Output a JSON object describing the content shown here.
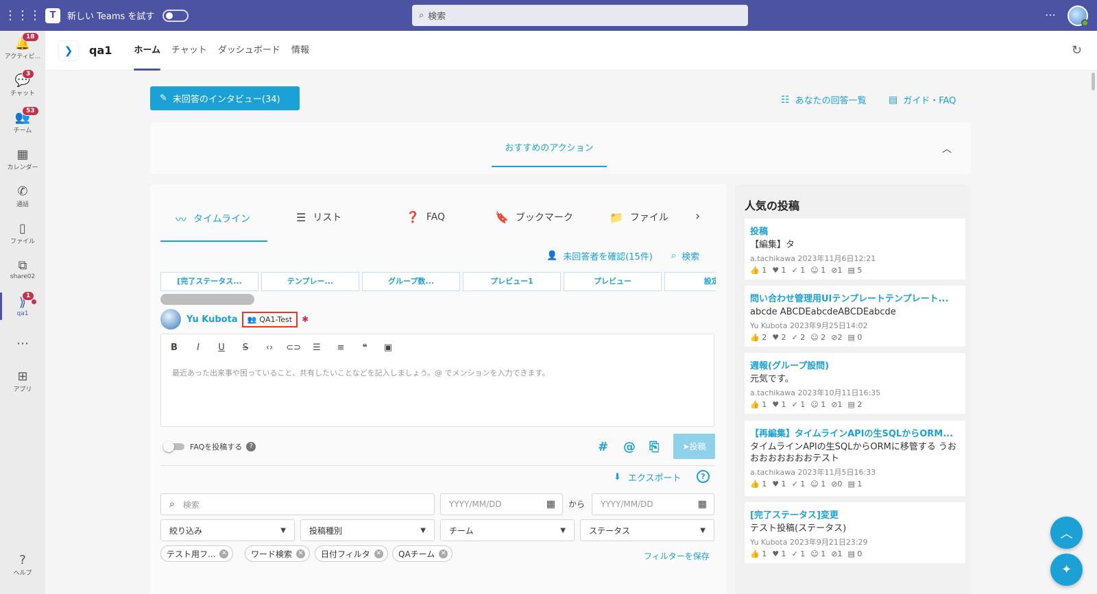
{
  "topbar": {
    "try_label": "新しい Teams を試す",
    "search_placeholder": "検索",
    "more": "⋯"
  },
  "rail": [
    {
      "label": "アクティビ...",
      "badge": "18",
      "icon": "bell-icon",
      "glyph": "🔔"
    },
    {
      "label": "チャット",
      "badge": "3",
      "icon": "chat-icon",
      "glyph": "💬"
    },
    {
      "label": "チーム",
      "badge": "53",
      "icon": "teams-icon",
      "glyph": "👥"
    },
    {
      "label": "カレンダー",
      "badge": "",
      "icon": "calendar-icon",
      "glyph": "▦"
    },
    {
      "label": "通話",
      "badge": "",
      "icon": "phone-icon",
      "glyph": "✆"
    },
    {
      "label": "ファイル",
      "badge": "",
      "icon": "file-icon",
      "glyph": "▯"
    },
    {
      "label": "share02",
      "badge": "",
      "icon": "app-icon",
      "glyph": "⧉"
    },
    {
      "label": "qa1",
      "badge": "1",
      "icon": "qa1-icon",
      "glyph": "⟫"
    },
    {
      "label": "",
      "badge": "",
      "icon": "more-icon",
      "glyph": "⋯"
    },
    {
      "label": "アプリ",
      "badge": "",
      "icon": "apps-icon",
      "glyph": "⊞"
    },
    {
      "label": "ヘルプ",
      "badge": "",
      "icon": "help-icon",
      "glyph": "?"
    }
  ],
  "app": {
    "name": "qa1",
    "tabs": [
      "ホーム",
      "チャット",
      "ダッシュボード",
      "情報"
    ]
  },
  "main": {
    "unanswered_button": "未回答のインタビュー(34)",
    "my_answers_link": "あなたの回答一覧",
    "guide_link": "ガイド・FAQ",
    "recommended_tab": "おすすめのアクション"
  },
  "timeline": {
    "tabs": [
      "タイムライン",
      "リスト",
      "FAQ",
      "ブックマーク",
      "ファイル"
    ],
    "check_unanswered": "未回答者を確認(15件)",
    "search_link": "検索",
    "chips": [
      "[完了ステータス...",
      "テンプレー...",
      "グループ数...",
      "プレビュー1",
      "プレビュー",
      "設定ｵ"
    ],
    "author_name": "Yu Kubota",
    "group_name": "QA1-Test",
    "editor_placeholder": "最近あった出来事や困っていること、共有したいことなどを記入しましょう。@ でメンションを入力できます。",
    "faq_toggle": "FAQを投稿する",
    "post_button": "投稿",
    "export": "エクスポート",
    "search_placeholder": "検索",
    "date_placeholder_from": "YYYY/MM/DD",
    "kara": "から",
    "date_placeholder_to": "YYYY/MM/DD",
    "filters": [
      "絞り込み",
      "投稿種別",
      "チーム",
      "ステータス"
    ],
    "tags": [
      "テスト用フ...",
      "ワード検索",
      "日付フィルタ",
      "QAチーム"
    ],
    "save_filter": "フィルターを保存"
  },
  "popular": {
    "title": "人気の投稿",
    "posts": [
      {
        "title": "投稿",
        "body": "【編集】タ",
        "meta": "a.tachikawa  2023年11月6日12:21",
        "stats": [
          "👍 1",
          "♥ 1",
          "✓ 1",
          "☺ 1",
          "⊘1",
          "▤ 5"
        ]
      },
      {
        "title": "問い合わせ管理用UIテンプレートテンプレート...",
        "body": "abcde ABCDEabcdeABCDEabcde",
        "meta": "Yu Kubota  2023年9月25日14:02",
        "stats": [
          "👍 2",
          "♥ 2",
          "✓ 2",
          "☺ 2",
          "⊘2",
          "▤ 0"
        ]
      },
      {
        "title": "週報(グループ設問)",
        "body": "元気です。",
        "meta": "a.tachikawa  2023年10月11日16:35",
        "stats": [
          "👍 1",
          "♥ 1",
          "✓ 1",
          "☺ 1",
          "⊘1",
          "▤ 2"
        ]
      },
      {
        "title": "【再編集】タイムラインAPIの生SQLからORM...",
        "body": "タイムラインAPIの生SQLからORMに移管する うおおおおおおおおテスト",
        "meta": "a.tachikawa  2023年11月5日16:33",
        "stats": [
          "👍 1",
          "♥ 1",
          "✓ 1",
          "☺ 1",
          "⊘0",
          "▤ 1"
        ]
      },
      {
        "title": "[完了ステータス]変更",
        "body": "テスト投稿(ステータス)",
        "meta": "Yu Kubota  2023年9月21日23:29",
        "stats": [
          "👍 1",
          "♥ 1",
          "✓ 1",
          "☺ 1",
          "⊘1",
          "▤ 0"
        ]
      }
    ]
  },
  "colors": {
    "teams_purple": "#4b53a2",
    "accent": "#1ba1d5",
    "badge_red": "#c4314b"
  }
}
